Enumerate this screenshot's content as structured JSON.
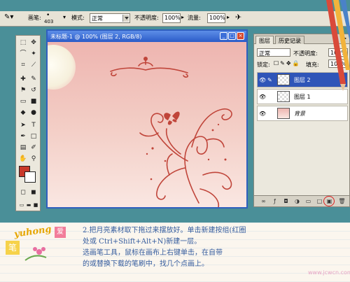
{
  "options_bar": {
    "brush_label": "画笔:",
    "brush_size": "403",
    "mode_label": "模式:",
    "mode_value": "正常",
    "opacity_label": "不透明度:",
    "opacity_value": "100%",
    "flow_label": "流量:",
    "flow_value": "100%"
  },
  "document": {
    "title": "未标题-1 @ 100% (图层 2, RGB/8)"
  },
  "layers_panel": {
    "tabs": [
      "图层",
      "历史记录"
    ],
    "blend_mode": "正常",
    "opacity_label": "不透明度:",
    "opacity_value": "100%",
    "lock_label": "锁定:",
    "fill_label": "填充:",
    "fill_value": "100%",
    "layers": [
      {
        "name": "图层 2",
        "selected": true
      },
      {
        "name": "图层 1",
        "selected": false
      },
      {
        "name": "背景",
        "selected": false
      }
    ]
  },
  "caption": {
    "line1": "2.把月亮素材取下拖过来摆放好。单击新建按组(红圈",
    "line2": "处或 Ctrl+Shift+Alt+N)新建一层。",
    "line3": "选画笔工具，鼠标在画布上右键单击，在自带",
    "line4": "的或替换下载的笔刷中，找几个点画上。"
  },
  "logo": {
    "text": "yuhong",
    "mark1": "笔",
    "mark2": "爱"
  },
  "watermark": "www.jcwcn.com",
  "colors": {
    "foreground": "#c8382a",
    "background": "#ffffff",
    "selection": "#2f55b8",
    "canvas_top": "#eeb5b0"
  }
}
